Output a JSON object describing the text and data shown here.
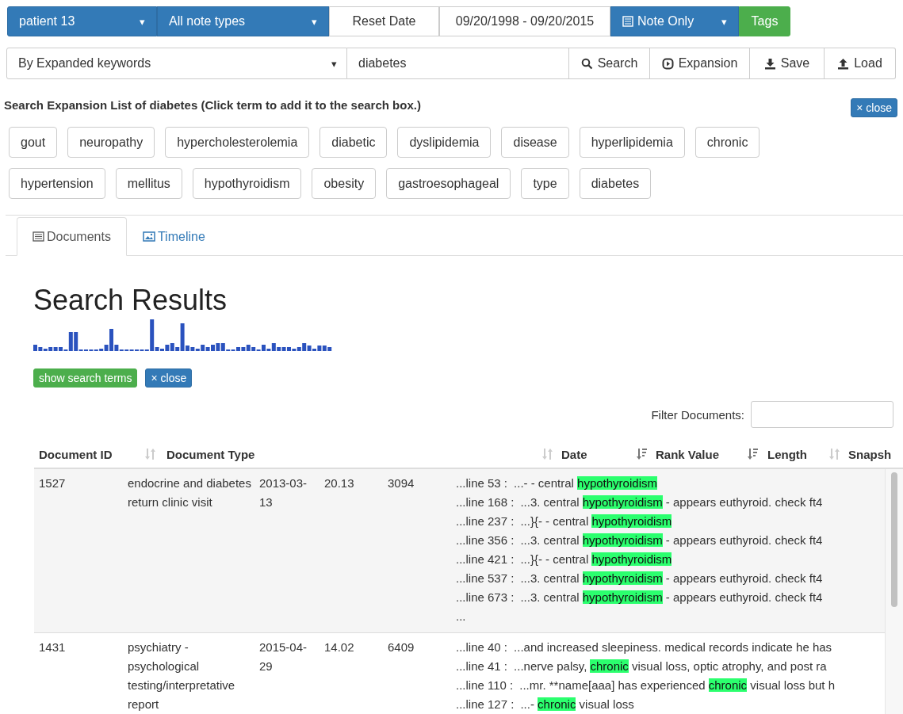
{
  "toolbar": {
    "patient": {
      "label": "patient 13",
      "caret": "▾"
    },
    "note_types": {
      "label": "All note types",
      "caret": "▾"
    },
    "reset": "Reset Date",
    "date_range": "09/20/1998 - 09/20/2015",
    "note_only": {
      "label": "Note Only",
      "caret": "▾"
    },
    "tags": "Tags"
  },
  "search_bar": {
    "mode": {
      "label": "By Expanded keywords",
      "caret": "▾"
    },
    "query": "diabetes",
    "buttons": [
      {
        "kind": "search",
        "label": "Search"
      },
      {
        "kind": "expansion",
        "label": "Expansion"
      },
      {
        "kind": "save",
        "label": "Save"
      },
      {
        "kind": "load",
        "label": "Load"
      }
    ]
  },
  "expansion": {
    "title": "Search Expansion List of diabetes (Click term to add it to the search box.)",
    "close": "× close",
    "terms": [
      [
        "gout",
        "neuropathy",
        "hypercholesterolemia",
        "diabetic",
        "dyslipidemia",
        "disease",
        "hyperlipidemia",
        "chronic"
      ],
      [
        "hypertension",
        "mellitus",
        "hypothyroidism",
        "obesity",
        "gastroesophageal",
        "type",
        "diabetes"
      ]
    ]
  },
  "tabs": [
    {
      "label": "Documents",
      "kind": "list",
      "selected": true
    },
    {
      "label": "Timeline",
      "kind": "image",
      "selected": false
    }
  ],
  "results": {
    "title": "Search Results",
    "show_terms": "show search terms",
    "close": "× close",
    "filter_label": "Filter Documents:"
  },
  "table": {
    "columns": [
      {
        "label": "Document ID",
        "sorted": false
      },
      {
        "label": "Document Type",
        "sorted": false
      },
      {
        "label": "Date",
        "sorted": true
      },
      {
        "label": "Rank Value",
        "sorted": true
      },
      {
        "label": "Length",
        "sorted": false
      },
      {
        "label": "Snapsh"
      }
    ],
    "rows": [
      {
        "id": "1527",
        "type": "endocrine and diabetes return clinic visit",
        "date": "2013-03-13",
        "rank": "20.13",
        "length": "3094",
        "more": "...",
        "snippets": [
          {
            "line": "...line 53 :",
            "before": "...- - central ",
            "term": "hypothyroidism"
          },
          {
            "line": "...line 168 :",
            "before": "...3. central ",
            "term": "hypothyroidism",
            "after": " - appears euthyroid. check ft4"
          },
          {
            "line": "...line 237 :",
            "before": "...}{- - central ",
            "term": "hypothyroidism"
          },
          {
            "line": "...line 356 :",
            "before": "...3. central ",
            "term": "hypothyroidism",
            "after": " - appears euthyroid. check ft4"
          },
          {
            "line": "...line 421 :",
            "before": "...}{- - central ",
            "term": "hypothyroidism"
          },
          {
            "line": "...line 537 :",
            "before": "...3. central ",
            "term": "hypothyroidism",
            "after": " - appears euthyroid. check ft4"
          },
          {
            "line": "...line 673 :",
            "before": "...3. central ",
            "term": "hypothyroidism",
            "after": " - appears euthyroid. check ft4"
          }
        ]
      },
      {
        "id": "1431",
        "type": "psychiatry - psychological testing/interpretative report",
        "date": "2015-04-29",
        "rank": "14.02",
        "length": "6409",
        "snippets": [
          {
            "line": "...line 40 :",
            "before": "...and increased sleepiness. medical records indicate he has"
          },
          {
            "line": "...line 41 :",
            "before": "...nerve palsy, ",
            "term": "chronic",
            "after": " visual loss, optic atrophy, and post ra"
          },
          {
            "line": "...line 110 :",
            "before": "...mr. **name[aaa] has experienced ",
            "term": "chronic",
            "after": " visual loss but h"
          },
          {
            "line": "...line 127 :",
            "before": "...- ",
            "term": "chronic",
            "after": " visual loss"
          }
        ]
      }
    ]
  }
}
